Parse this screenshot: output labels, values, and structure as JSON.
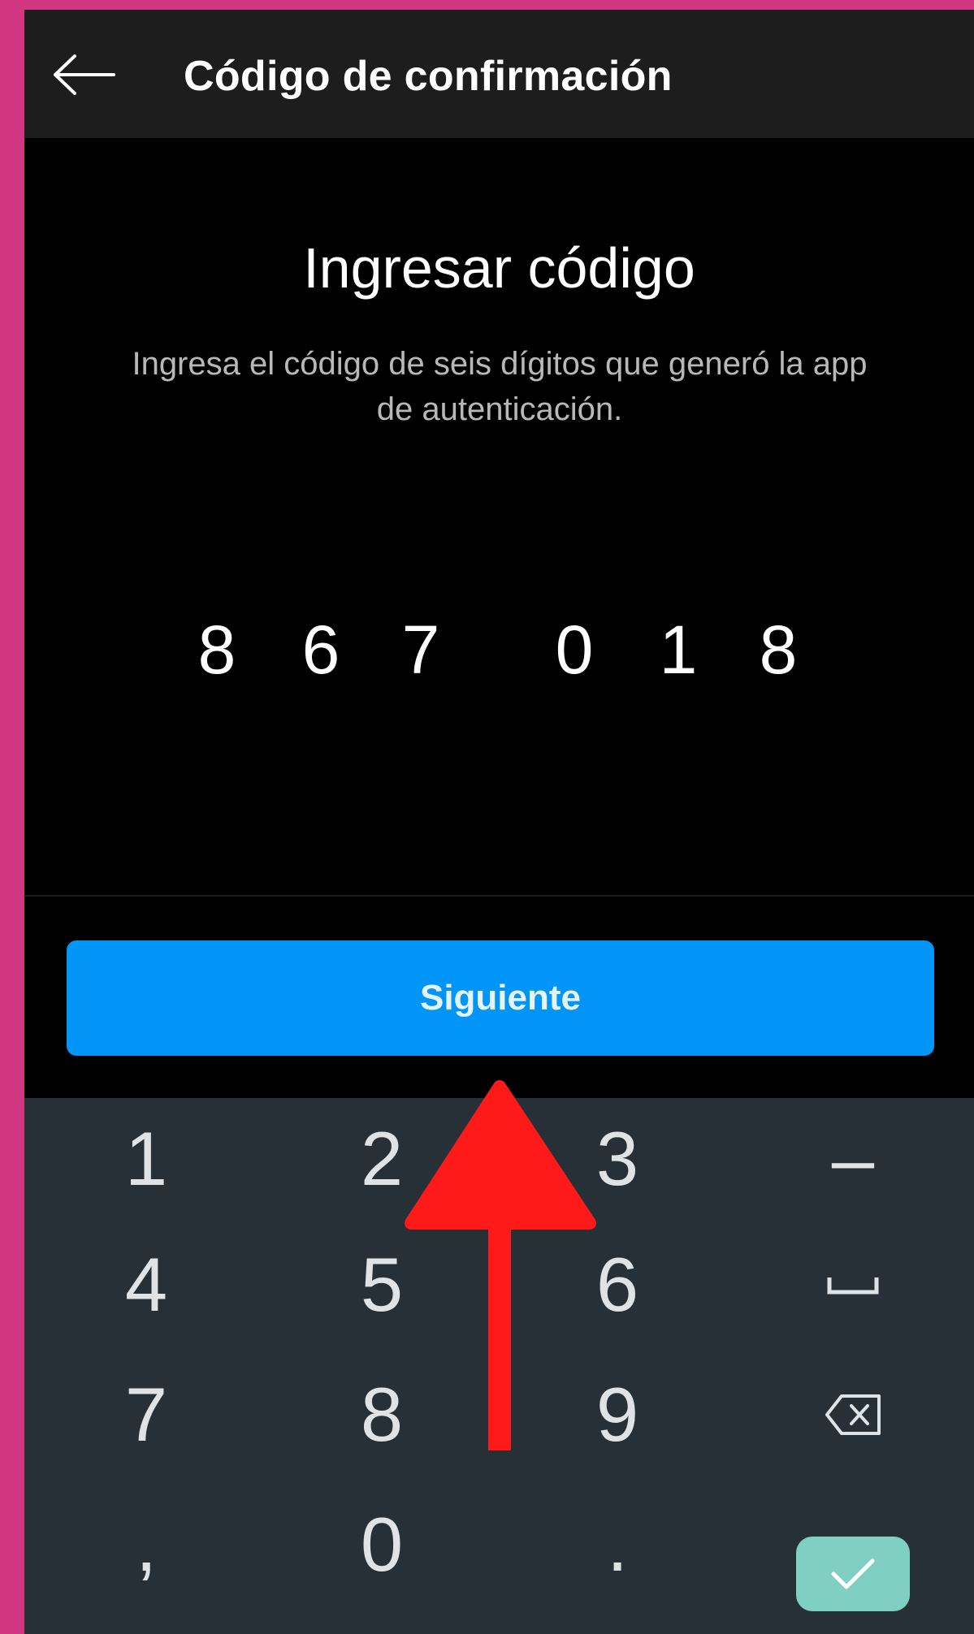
{
  "header": {
    "title": "Código de confirmación",
    "back_icon": "arrow-left-icon"
  },
  "main": {
    "heading": "Ingresar código",
    "description": "Ingresa el código de seis dígitos que generó la app de autenticación.",
    "code_digits": [
      "8",
      "6",
      "7",
      "0",
      "1",
      "8"
    ],
    "next_label": "Siguiente"
  },
  "keyboard": {
    "keys": [
      "1",
      "2",
      "3",
      "–",
      "4",
      "5",
      "6",
      "space",
      "7",
      "8",
      "9",
      "backspace",
      ",",
      "0",
      ".",
      "done"
    ],
    "icons": {
      "space": "space-bar-icon",
      "backspace": "backspace-icon",
      "done": "checkmark-icon"
    }
  },
  "annotation": {
    "arrow_icon": "red-up-arrow-icon"
  },
  "colors": {
    "frame": "#d13682",
    "header_bg": "#1d1d1d",
    "accent_button": "#0095f6",
    "keyboard_bg": "#263036",
    "done_key": "#7fcfc3",
    "arrow": "#ff1a1a"
  }
}
